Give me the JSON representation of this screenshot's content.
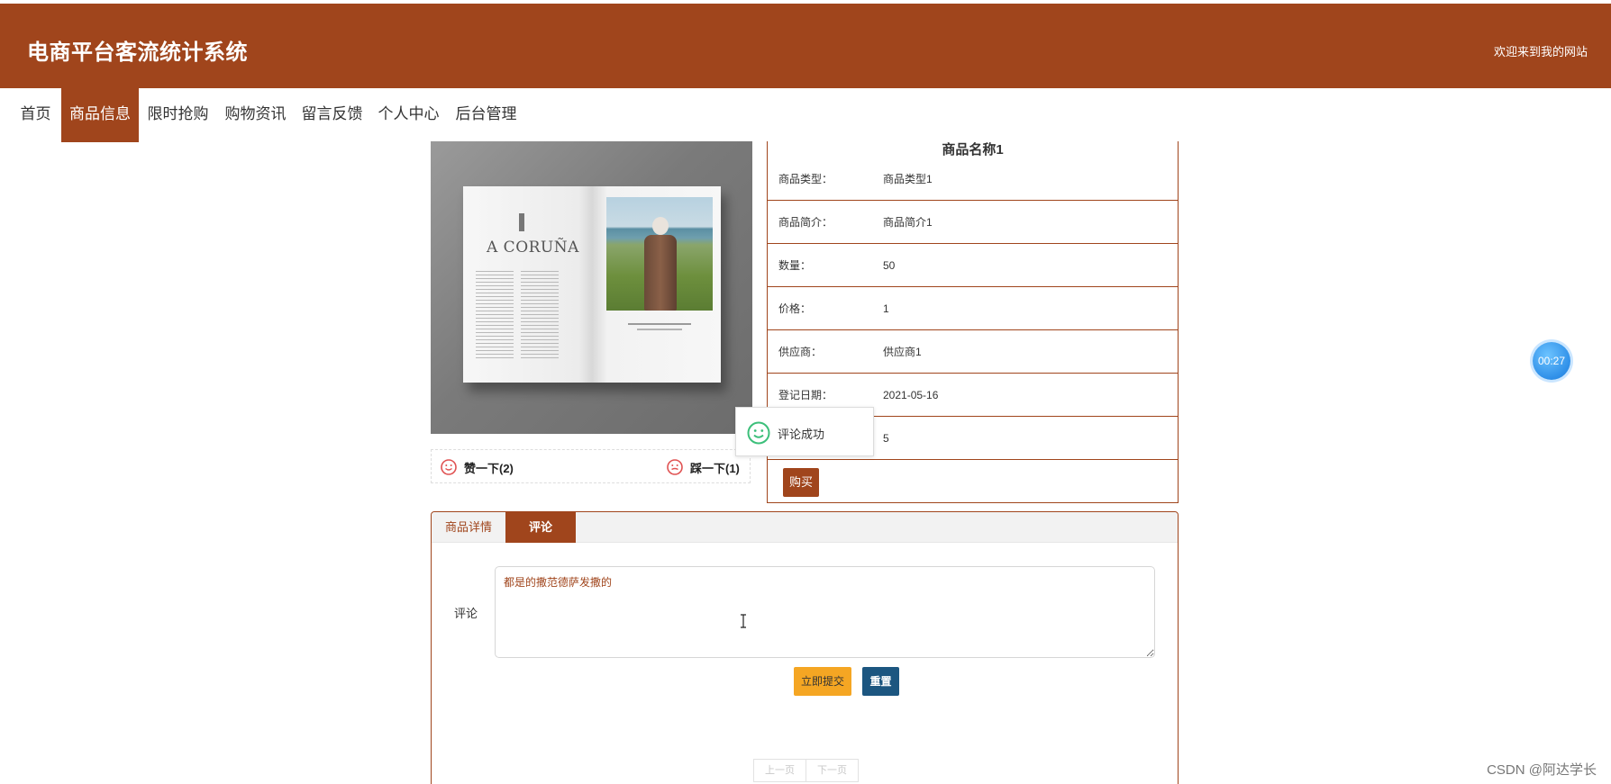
{
  "header": {
    "site_title": "电商平台客流统计系统",
    "welcome": "欢迎来到我的网站",
    "bg_color": "#a0451c"
  },
  "nav": {
    "items": [
      {
        "label": "首页",
        "active": false
      },
      {
        "label": "商品信息",
        "active": true
      },
      {
        "label": "限时抢购",
        "active": false
      },
      {
        "label": "购物资讯",
        "active": false
      },
      {
        "label": "留言反馈",
        "active": false
      },
      {
        "label": "个人中心",
        "active": false
      },
      {
        "label": "后台管理",
        "active": false
      }
    ]
  },
  "product": {
    "image_text": "A CORUÑA",
    "name": "商品名称1",
    "fields": [
      {
        "label": "商品类型：",
        "value": "商品类型1"
      },
      {
        "label": "商品简介：",
        "value": "商品简介1"
      },
      {
        "label": "数量：",
        "value": "50"
      },
      {
        "label": "价格：",
        "value": "1"
      },
      {
        "label": "供应商：",
        "value": "供应商1"
      },
      {
        "label": "登记日期：",
        "value": "2021-05-16"
      },
      {
        "label": "",
        "value": "5"
      }
    ],
    "buy_label": "购买",
    "like_label": "赞一下(2)",
    "dislike_label": "踩一下(1)"
  },
  "toast": {
    "text": "评论成功",
    "icon": "smile-icon"
  },
  "timer": {
    "text": "00:27"
  },
  "tabs": {
    "items": [
      {
        "label": "商品详情",
        "active": false
      },
      {
        "label": "评论",
        "active": true
      }
    ]
  },
  "comment": {
    "label": "评论",
    "value": "都是的撒范德萨发撒的",
    "submit_label": "立即提交",
    "reset_label": "重置"
  },
  "pager": {
    "prev_label": "上一页",
    "next_label": "下一页"
  },
  "watermark": "CSDN @阿达学长"
}
